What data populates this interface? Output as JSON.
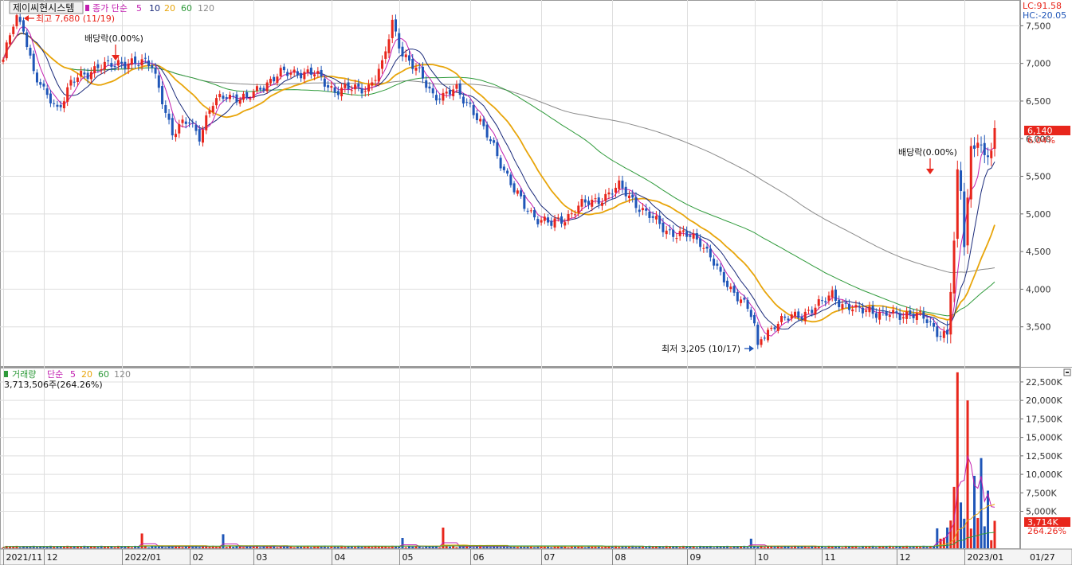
{
  "top_panel": {
    "stock_name": "제이씨현시스템",
    "legend_prefix": "종가 단순",
    "ma_labels": [
      "5",
      "10",
      "20",
      "60",
      "120"
    ],
    "lc_label": "LC:91.58",
    "hc_label": "HC:-20.05",
    "high_annotation": "최고 7,680 (11/19)",
    "low_annotation": "최저 3,205 (10/17)",
    "dividend_label": "배당락(0.00%)",
    "price_badge": "6,140",
    "price_change": "6.04%",
    "y_ticks": [
      "7,500",
      "7,000",
      "6,500",
      "6,000",
      "5,500",
      "5,000",
      "4,500",
      "4,000",
      "3,500"
    ]
  },
  "volume_panel": {
    "legend_prefix": "거래량",
    "legend_mode": "단순",
    "ma_labels": [
      "5",
      "20",
      "60",
      "120"
    ],
    "current_value": "3,713,506주(264.26%)",
    "badge_value": "3,714K",
    "badge_pct": "264.26%",
    "y_ticks": [
      "22,500K",
      "20,000K",
      "17,500K",
      "15,000K",
      "12,500K",
      "10,000K",
      "7,500K",
      "5,000K"
    ]
  },
  "x_axis": {
    "labels": [
      "2021/11",
      "12",
      "2022/01",
      "02",
      "03",
      "04",
      "05",
      "06",
      "07",
      "08",
      "09",
      "10",
      "11",
      "12",
      "2023/01"
    ],
    "current_date": "01/27"
  },
  "colors": {
    "up": "#e8261c",
    "down": "#1f56b8",
    "ma5": "#c21fb0",
    "ma10": "#1a2a7a",
    "ma20": "#e8a50b",
    "ma60": "#2e9a3a",
    "ma120": "#8a8a8a",
    "grid": "#dedede"
  },
  "chart_data": [
    {
      "type": "candlestick",
      "title": "제이씨현시스템",
      "period": "2021/11 - 2023/01 (daily)",
      "ylim": [
        3000,
        7800
      ],
      "high": {
        "value": 7680,
        "date": "11/19"
      },
      "low": {
        "value": 3205,
        "date": "10/17"
      },
      "last_close": 6140,
      "last_change_pct": 6.04,
      "monthly_close_approx": [
        {
          "month": "2021/11",
          "close": 7050
        },
        {
          "month": "2021/12",
          "close": 6900
        },
        {
          "month": "2022/01",
          "close": 6450
        },
        {
          "month": "2022/02",
          "close": 6600
        },
        {
          "month": "2022/03",
          "close": 6800
        },
        {
          "month": "2022/04",
          "close": 6700
        },
        {
          "month": "2022/05",
          "close": 6500
        },
        {
          "month": "2022/06",
          "close": 5200
        },
        {
          "month": "2022/07",
          "close": 5000
        },
        {
          "month": "2022/08",
          "close": 4950
        },
        {
          "month": "2022/09",
          "close": 4300
        },
        {
          "month": "2022/10",
          "close": 3500
        },
        {
          "month": "2022/11",
          "close": 3750
        },
        {
          "month": "2022/12",
          "close": 4500
        },
        {
          "month": "2023/01",
          "close": 6140
        }
      ],
      "moving_averages": [
        "5",
        "10",
        "20",
        "60",
        "120"
      ]
    },
    {
      "type": "bar",
      "title": "거래량",
      "ylim": [
        0,
        24000
      ],
      "unit": "K",
      "last_value": 3714,
      "last_value_pct": 264.26,
      "notable_spikes_k": [
        {
          "month": "2022/12",
          "value": 23800
        },
        {
          "month": "2023/01",
          "value": 20000
        },
        {
          "month": "2023/01",
          "value": 12200
        },
        {
          "month": "2023/01",
          "value": 9800
        },
        {
          "month": "2023/01",
          "value": 7800
        }
      ]
    }
  ]
}
